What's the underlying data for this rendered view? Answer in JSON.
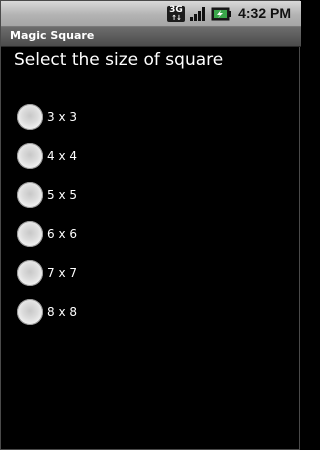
{
  "status_bar": {
    "network_icon": "3g-data-icon",
    "network_label": "3G",
    "signal_icon": "signal-strength-icon",
    "battery_icon": "battery-charging-icon",
    "time": "4:32 PM"
  },
  "app": {
    "title": "Magic Square"
  },
  "main": {
    "heading": "Select the size of square",
    "options": [
      {
        "label": "3 x 3"
      },
      {
        "label": "4 x 4"
      },
      {
        "label": "5 x 5"
      },
      {
        "label": "6 x 6"
      },
      {
        "label": "7 x 7"
      },
      {
        "label": "8 x 8"
      }
    ]
  },
  "colors": {
    "background": "#000000",
    "status_bar": "#c0c0c0",
    "title_bar": "#5a5a5a",
    "battery_green": "#3aa64a"
  }
}
